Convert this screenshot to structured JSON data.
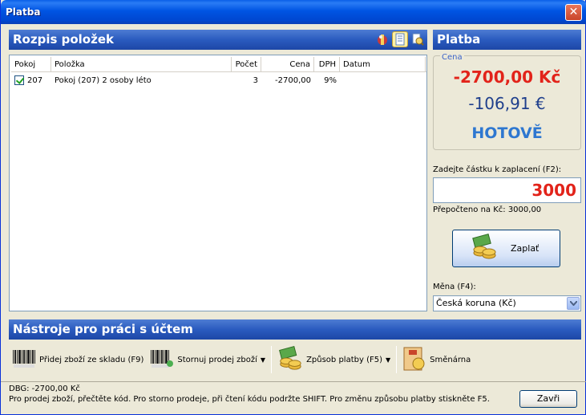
{
  "window": {
    "title": "Platba",
    "close_glyph": "✕"
  },
  "items_panel": {
    "title": "Rozpis položek",
    "icons": [
      "gift-icon",
      "document-list-icon",
      "search-document-icon"
    ],
    "columns": [
      "Pokoj",
      "Položka",
      "Počet",
      "Cena",
      "DPH",
      "Datum"
    ],
    "rows": [
      {
        "checked": true,
        "pokoj": "207",
        "polozka": "Pokoj (207) 2 osoby léto",
        "pocet": "3",
        "cena": "-2700,00",
        "dph": "9%",
        "datum": ""
      }
    ]
  },
  "payment_panel": {
    "title": "Platba",
    "price_legend": "Cena",
    "price_czk": "-2700,00 Kč",
    "price_eur": "-106,91 €",
    "payment_state": "HOTOVĚ",
    "amount_label": "Zadejte částku k zaplacení (F2):",
    "amount_value": "3000",
    "converted_text": "Přepočteno na Kč: 3000,00",
    "pay_button_label": "Zaplať",
    "currency_label": "Měna (F4):",
    "currency_value": "Česká koruna (Kč)"
  },
  "tools_panel": {
    "title": "Nástroje pro práci s účtem",
    "buttons": [
      {
        "label": "Přidej zboží ze skladu (F9)",
        "icon": "barcode-icon"
      },
      {
        "label": "Stornuj prodej zboží",
        "icon": "barcode-storno-icon"
      },
      {
        "label": "Způsob platby (F5)",
        "icon": "money-bag-icon"
      },
      {
        "label": "Směnárna",
        "icon": "exchange-icon"
      }
    ]
  },
  "status": {
    "line1": "DBG: -2700,00 Kč",
    "line2": "Pro prodej zboží, přečtěte kód. Pro storno prodeje, při čtení kódu podržte SHIFT. Pro změnu způsobu platby stiskněte F5.",
    "close_button": "Zavři"
  },
  "colors": {
    "accent_blue": "#1d47a6",
    "price_red": "#e2231a",
    "price_dark_blue": "#1f3f8c",
    "cash_blue": "#2e77d0"
  }
}
